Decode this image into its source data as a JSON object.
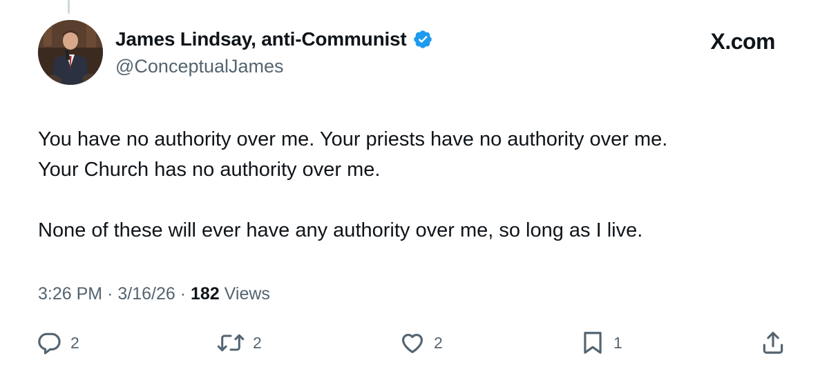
{
  "author": {
    "display_name": "James Lindsay, anti-Communist",
    "handle": "@ConceptualJames",
    "verified": true
  },
  "brand": "X.com",
  "tweet": {
    "paragraphs": [
      "You have no authority over me. Your priests have no authority over me.\nYour Church has no authority over me.",
      "None of these will ever have any authority over me, so long as I live."
    ],
    "time": "3:26 PM",
    "date": "3/16/26",
    "views_count": "182",
    "views_label": "Views"
  },
  "actions": {
    "replies": "2",
    "reposts": "2",
    "likes": "2",
    "bookmarks": "1"
  },
  "colors": {
    "text": "#0f1419",
    "secondary": "#536471",
    "verified": "#1d9bf0"
  },
  "icons": [
    "verified-badge-icon",
    "reply-icon",
    "repost-icon",
    "like-icon",
    "bookmark-icon",
    "share-icon"
  ]
}
